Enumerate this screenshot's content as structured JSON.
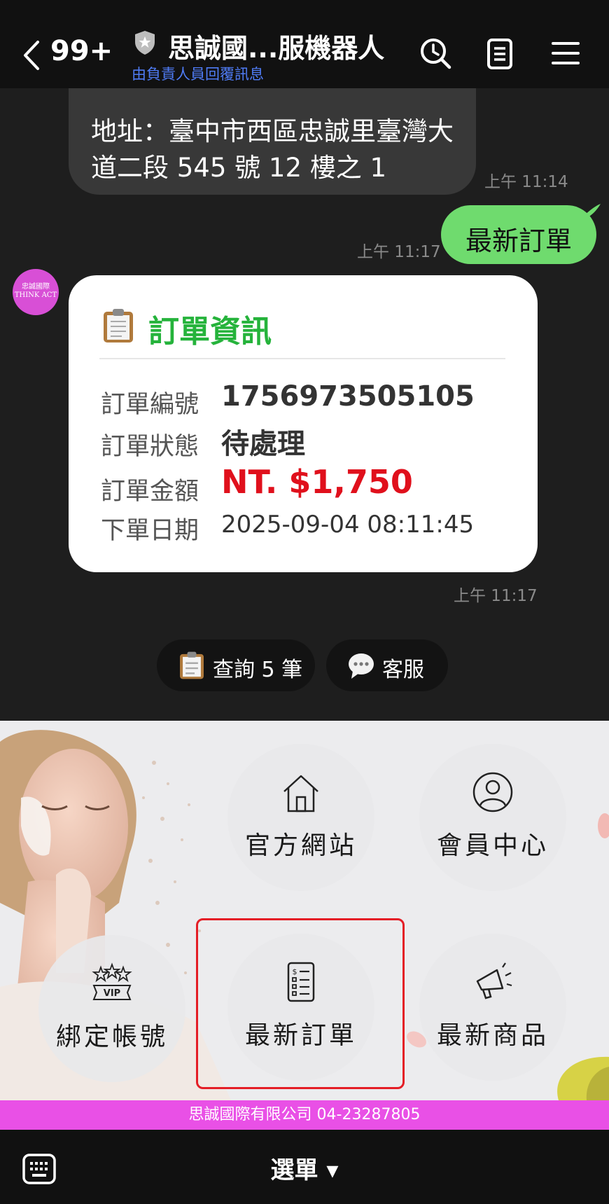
{
  "header": {
    "unread_count": "99+",
    "title": "思誠國...服機器人",
    "subtitle": "由負責人員回覆訊息"
  },
  "messages": {
    "address_text": "地址：臺中市西區忠誠里臺灣大道二段 545 號 12 樓之 1",
    "address_time": "上午 11:14",
    "user_text": "最新訂單",
    "user_time": "上午 11:17",
    "avatar_text": "忠誠國際 THINK ACT",
    "card_time": "上午 11:17"
  },
  "order_card": {
    "title": "訂單資訊",
    "rows": [
      {
        "label": "訂單編號",
        "value": "1756973505105"
      },
      {
        "label": "訂單狀態",
        "value": "待處理"
      },
      {
        "label": "訂單金額",
        "value": "NT. $1,750"
      },
      {
        "label": "下單日期",
        "value": "2025-09-04 08:11:45"
      }
    ],
    "amount_color": "#e0101c"
  },
  "quick_replies": [
    {
      "label": "查詢 5 筆",
      "icon": "clipboard-icon"
    },
    {
      "label": "客服",
      "icon": "speech-bubble-icon"
    }
  ],
  "rich_menu": {
    "items": [
      {
        "label": "官方網站",
        "icon": "house-icon"
      },
      {
        "label": "會員中心",
        "icon": "user-circle-icon"
      },
      {
        "label": "綁定帳號",
        "icon": "vip-icon"
      },
      {
        "label": "最新訂單",
        "icon": "order-list-icon"
      },
      {
        "label": "最新商品",
        "icon": "megaphone-icon"
      }
    ],
    "footer": "思誠國際有限公司  04-23287805",
    "footer_color": "#e950e6"
  },
  "bottom_bar": {
    "menu_label": "選單 ▾"
  },
  "colors": {
    "accent_green": "#6fdb6e",
    "title_green": "#25b33b",
    "link_blue": "#4f7cf5",
    "highlight_red": "#e41e26"
  }
}
